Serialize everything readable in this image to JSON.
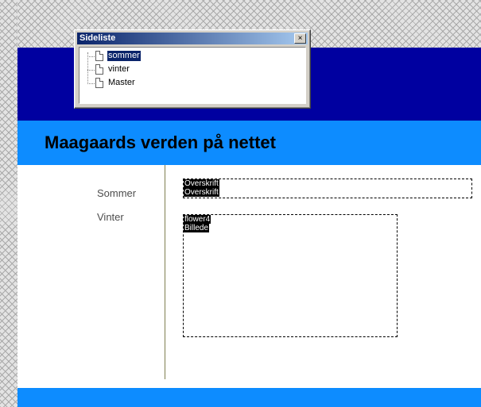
{
  "site": {
    "title": "Maagaards verden på nettet",
    "nav": [
      "Sommer",
      "Vinter"
    ]
  },
  "placeholders": {
    "heading": {
      "tags": [
        "Overskrift",
        "Overskrift"
      ]
    },
    "image": {
      "tags": [
        "flower4",
        "Billede"
      ]
    }
  },
  "panel": {
    "title": "Sideliste",
    "close_label": "×",
    "close_icon": "close-icon",
    "items": [
      {
        "label": "sommer",
        "selected": true,
        "icon": "page-icon"
      },
      {
        "label": "vinter",
        "selected": false,
        "icon": "page-icon"
      },
      {
        "label": "Master",
        "selected": false,
        "icon": "page-icon"
      }
    ]
  },
  "colors": {
    "navy_band": "#0000a0",
    "title_band": "#0d8cff",
    "selection": "#0a246a",
    "nav_text": "#4d4d4d"
  }
}
